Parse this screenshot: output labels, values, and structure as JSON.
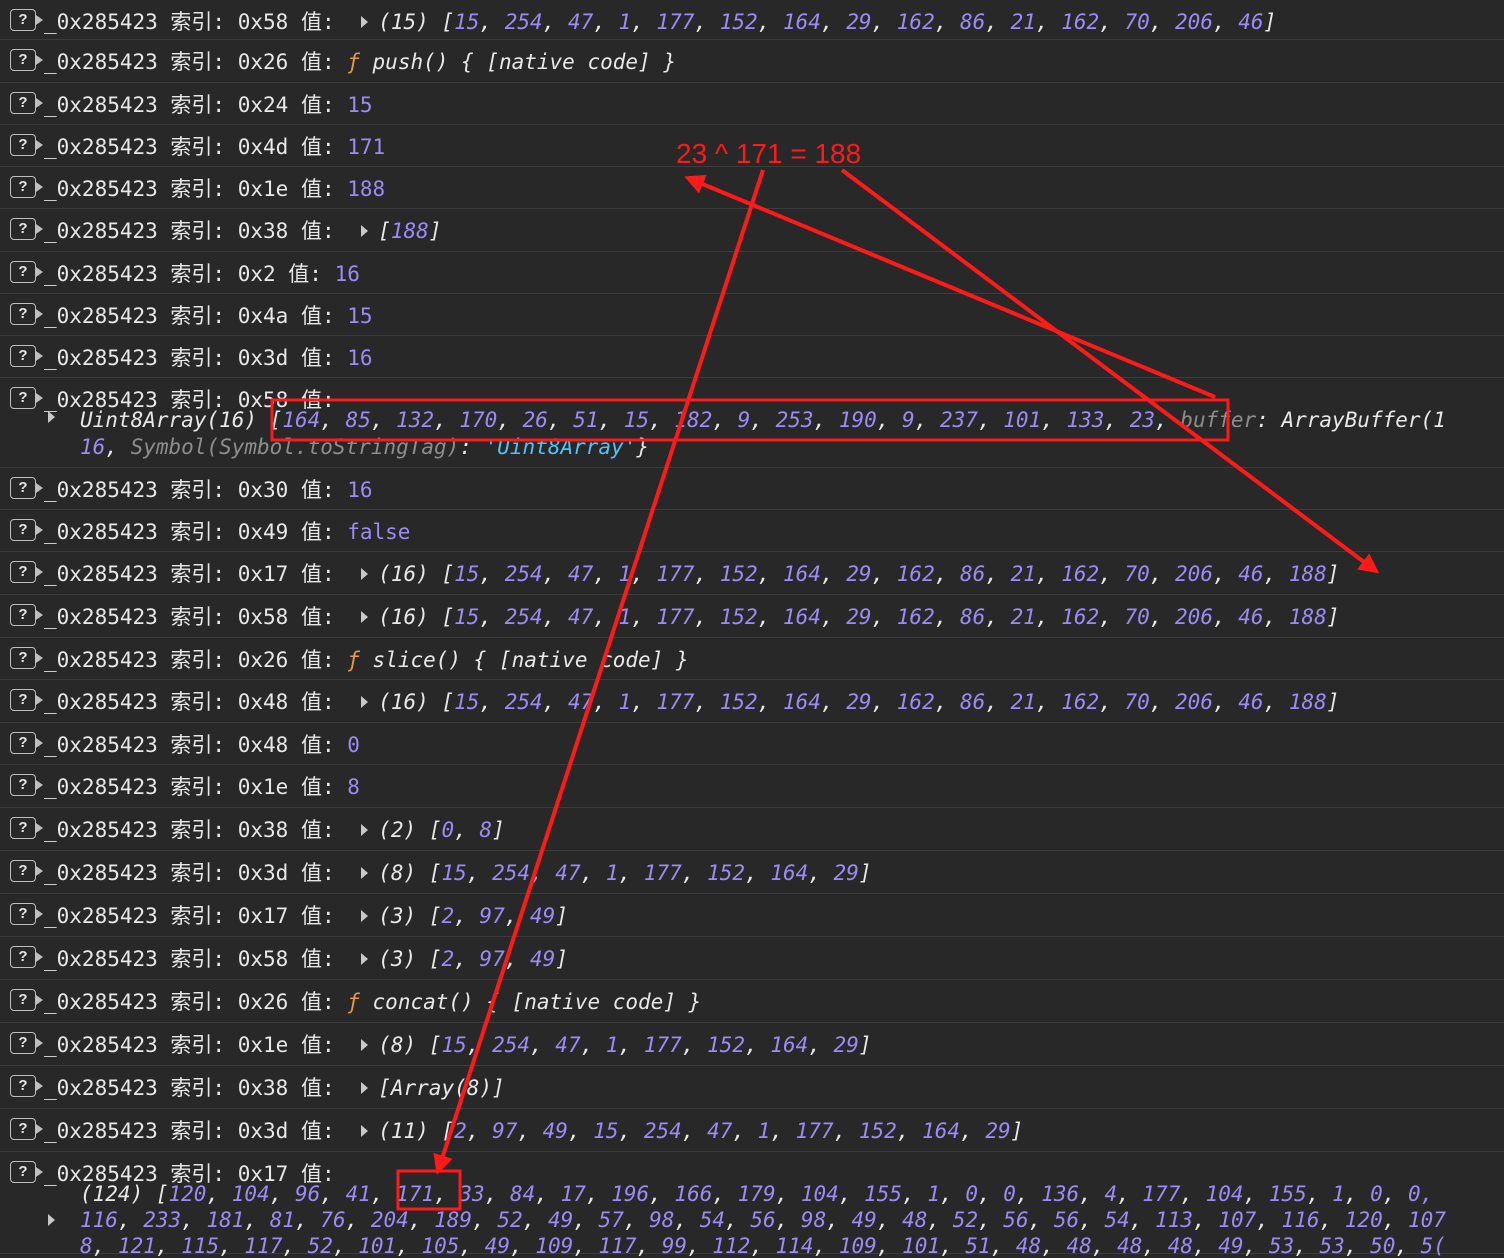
{
  "prefix": "_0x285423 索引:",
  "value_label": "值:",
  "rows": [
    {
      "i": "0x58",
      "type": "array",
      "expand": "(15)",
      "values": [
        "15",
        "254",
        "47",
        "1",
        "177",
        "152",
        "164",
        "29",
        "162",
        "86",
        "21",
        "162",
        "70",
        "206",
        "46"
      ]
    },
    {
      "i": "0x26",
      "type": "func",
      "text": "push() { [native code] }"
    },
    {
      "i": "0x24",
      "type": "num",
      "text": "15"
    },
    {
      "i": "0x4d",
      "type": "num",
      "text": "171"
    },
    {
      "i": "0x1e",
      "type": "num",
      "text": "188"
    },
    {
      "i": "0x38",
      "type": "array",
      "expand": "",
      "values": [
        "188"
      ]
    },
    {
      "i": "0x2",
      "type": "num",
      "text": "16"
    },
    {
      "i": "0x4a",
      "type": "num",
      "text": "15"
    },
    {
      "i": "0x3d",
      "type": "num",
      "text": "16"
    },
    {
      "i": "0x58",
      "type": "typed"
    },
    {
      "i": "0x30",
      "type": "num",
      "text": "16"
    },
    {
      "i": "0x49",
      "type": "num",
      "text": "false"
    },
    {
      "i": "0x17",
      "type": "array",
      "expand": "(16)",
      "values": [
        "15",
        "254",
        "47",
        "1",
        "177",
        "152",
        "164",
        "29",
        "162",
        "86",
        "21",
        "162",
        "70",
        "206",
        "46",
        "188"
      ]
    },
    {
      "i": "0x58",
      "type": "array",
      "expand": "(16)",
      "values": [
        "15",
        "254",
        "47",
        "1",
        "177",
        "152",
        "164",
        "29",
        "162",
        "86",
        "21",
        "162",
        "70",
        "206",
        "46",
        "188"
      ]
    },
    {
      "i": "0x26",
      "type": "func",
      "text": "slice() { [native code] }"
    },
    {
      "i": "0x48",
      "type": "array",
      "expand": "(16)",
      "values": [
        "15",
        "254",
        "47",
        "1",
        "177",
        "152",
        "164",
        "29",
        "162",
        "86",
        "21",
        "162",
        "70",
        "206",
        "46",
        "188"
      ]
    },
    {
      "i": "0x48",
      "type": "num",
      "text": "0"
    },
    {
      "i": "0x1e",
      "type": "num",
      "text": "8"
    },
    {
      "i": "0x38",
      "type": "array",
      "expand": "(2)",
      "values": [
        "0",
        "8"
      ]
    },
    {
      "i": "0x3d",
      "type": "array",
      "expand": "(8)",
      "values": [
        "15",
        "254",
        "47",
        "1",
        "177",
        "152",
        "164",
        "29"
      ]
    },
    {
      "i": "0x17",
      "type": "array",
      "expand": "(3)",
      "values": [
        "2",
        "97",
        "49"
      ]
    },
    {
      "i": "0x58",
      "type": "array",
      "expand": "(3)",
      "values": [
        "2",
        "97",
        "49"
      ]
    },
    {
      "i": "0x26",
      "type": "func",
      "text": "concat() { [native code] }"
    },
    {
      "i": "0x1e",
      "type": "array",
      "expand": "(8)",
      "values": [
        "15",
        "254",
        "47",
        "1",
        "177",
        "152",
        "164",
        "29"
      ]
    },
    {
      "i": "0x38",
      "type": "raw",
      "text": "[Array(8)]"
    },
    {
      "i": "0x3d",
      "type": "array",
      "expand": "(11)",
      "values": [
        "2",
        "97",
        "49",
        "15",
        "254",
        "47",
        "1",
        "177",
        "152",
        "164",
        "29"
      ]
    },
    {
      "i": "0x17",
      "type": "big"
    }
  ],
  "typed": {
    "label": "Uint8Array(16)",
    "values": [
      "164",
      "85",
      "132",
      "170",
      "26",
      "51",
      "15",
      "182",
      "9",
      "253",
      "190",
      "9",
      "237",
      "101",
      "133",
      "23"
    ],
    "buffer_key": "buffer",
    "buffer_val": "ArrayBuffer(1",
    "line2_num": "16",
    "line2_sym": "Symbol(Symbol.toStringTag)",
    "line2_str": "'Uint8Array'"
  },
  "big": {
    "line1_prefix": "(124) [",
    "line1": [
      "120",
      "104",
      "96",
      "41",
      "171",
      "33",
      "84",
      "17",
      "196",
      "166",
      "179",
      "104",
      "155",
      "1",
      "0",
      "0",
      "136",
      "4",
      "177",
      "104",
      "155",
      "1",
      "0",
      "0,"
    ],
    "line2": [
      "116",
      "233",
      "181",
      "81",
      "76",
      "204",
      "189",
      "52",
      "49",
      "57",
      "98",
      "54",
      "56",
      "98",
      "49",
      "48",
      "52",
      "56",
      "56",
      "54",
      "113",
      "107",
      "116",
      "120",
      "107"
    ],
    "line3": [
      "8",
      "121",
      "115",
      "117",
      "52",
      "101",
      "105",
      "49",
      "109",
      "117",
      "99",
      "112",
      "114",
      "109",
      "101",
      "51",
      "48",
      "48",
      "48",
      "48",
      "49",
      "53",
      "53",
      "50",
      "5("
    ]
  },
  "annotation": {
    "text": "23 ^ 171 = 188",
    "color": "#ff1a1a"
  }
}
